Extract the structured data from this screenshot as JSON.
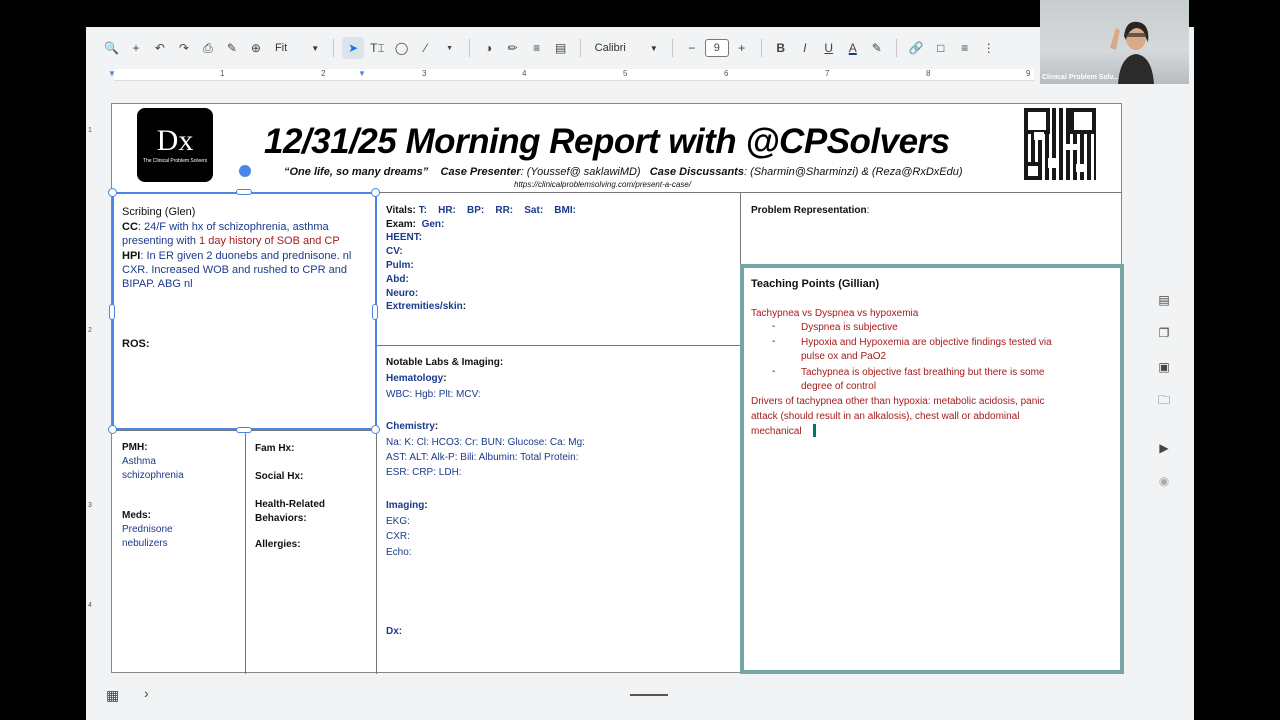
{
  "toolbar": {
    "zoom": "Fit",
    "font": "Calibri",
    "font_size": "9"
  },
  "ruler": {
    "marks": [
      "1",
      "2",
      "3",
      "4",
      "5",
      "6",
      "7",
      "8",
      "9"
    ]
  },
  "vruler": {
    "marks": [
      "1",
      "2",
      "3",
      "4"
    ]
  },
  "slide": {
    "logo_text": "Dx",
    "logo_sub": "The Clinical Problem Solvers",
    "title": "12/31/25 Morning Report with @CPSolvers",
    "motto": "“One life, so many dreams”",
    "presenter_label": "Case Presenter",
    "presenter": ": (Youssef@ saklawiMD)",
    "discussants_label": "Case Discussants",
    "discussants": ": (Sharmin@Sharminzi) & (Reza@RxDxEdu)",
    "url": "https://clinicalproblemsolving.com/present-a-case/",
    "scribing": {
      "heading": "Scribing (Glen)",
      "cc_label": "CC",
      "cc_text": ": 24/F with hx of schizophrenia, asthma",
      "cc_text2": "presenting with ",
      "cc_red": "1 day history of SOB and CP",
      "hpi_label": "HPI",
      "hpi_text": ":  In ER given 2 duonebs and prednisone. nl",
      "hpi_text2": "CXR. Increased WOB and rushed to CPR and",
      "hpi_text3": "BIPAP.  ABG nl",
      "ros": "ROS:"
    },
    "pmh": {
      "label": "PMH",
      "items": [
        "Asthma",
        "schizophrenia"
      ]
    },
    "meds": {
      "label": "Meds",
      "items": [
        "Prednisone",
        "nebulizers"
      ]
    },
    "fam_hx": "Fam Hx:",
    "social_hx": "Social Hx:",
    "health_behaviors": "Health-Related\nBehaviors:",
    "allergies": "Allergies:",
    "vitals": {
      "label": "Vitals:",
      "items": [
        "T:",
        "HR:",
        "BP:",
        "RR:",
        "Sat:",
        "BMI:"
      ]
    },
    "exam": {
      "label": "Exam:",
      "gen": "Gen:",
      "items": [
        "HEENT:",
        "CV:",
        "Pulm:",
        "Abd:",
        "Neuro:"
      ],
      "extremities_label": "Extremities/skin",
      "extremities_colon": ":"
    },
    "labs": {
      "heading": "Notable Labs & Imaging",
      "hematology_label": "Hematology",
      "hematology": "WBC:   Hgb:   Plt:   MCV:",
      "chemistry_label": "Chemistry",
      "chem1": "Na:   K:   Cl:   HCO3:   Cr:   BUN:   Glucose:   Ca:   Mg:",
      "chem2": "AST:   ALT:   Alk-P:   Bili:   Albumin:   Total Protein:",
      "chem3": "ESR:   CRP:   LDH:",
      "imaging_label": "Imaging",
      "imaging_items": [
        "EKG:",
        "CXR:",
        "Echo:"
      ],
      "dx": "Dx:"
    },
    "problem_rep": "Problem Representation",
    "teaching": {
      "heading": "Teaching Points (Gillian)",
      "line1": "Tachypnea  vs Dyspnea vs hypoxemia",
      "b1": "Dyspnea is subjective",
      "b2a": "Hypoxia and Hypoxemia are objective findings tested via",
      "b2b": "pulse ox and PaO2",
      "b3a": "Tachypnea  is objective fast breathing but there is some",
      "b3b": "degree of control",
      "p1": "Drivers of tachypnea other than hypoxia: metabolic acidosis, panic",
      "p2": "attack (should result in an alkalosis), chest wall or abdominal",
      "p3": "mechanical"
    }
  },
  "webcam": {
    "label": "Clinical Problem Solv..."
  },
  "colors": {
    "accent": "#4a86e8",
    "text_blue": "#1b3a8c",
    "text_red": "#a61c1c",
    "teach_border": "#76a5a5"
  }
}
